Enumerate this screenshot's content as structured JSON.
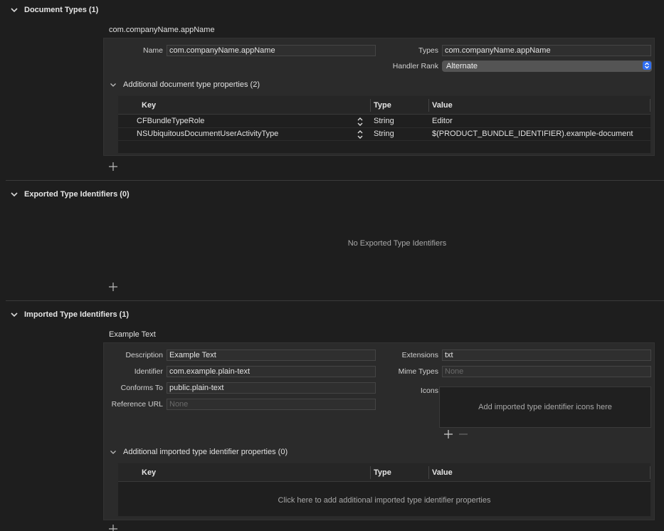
{
  "document_types": {
    "header": "Document Types (1)",
    "item_title": "com.companyName.appName",
    "name_label": "Name",
    "name_value": "com.companyName.appName",
    "types_label": "Types",
    "types_value": "com.companyName.appName",
    "handler_rank_label": "Handler Rank",
    "handler_rank_value": "Alternate",
    "additional_header": "Additional document type properties (2)",
    "table": {
      "columns": [
        "Key",
        "Type",
        "Value"
      ],
      "rows": [
        {
          "key": "CFBundleTypeRole",
          "type": "String",
          "value": "Editor"
        },
        {
          "key": "NSUbiquitousDocumentUserActivityType",
          "type": "String",
          "value": "$(PRODUCT_BUNDLE_IDENTIFIER).example-document"
        }
      ]
    }
  },
  "exported_types": {
    "header": "Exported Type Identifiers (0)",
    "empty_message": "No Exported Type Identifiers"
  },
  "imported_types": {
    "header": "Imported Type Identifiers (1)",
    "item_title": "Example Text",
    "description_label": "Description",
    "description_value": "Example Text",
    "identifier_label": "Identifier",
    "identifier_value": "com.example.plain-text",
    "conforms_label": "Conforms To",
    "conforms_value": "public.plain-text",
    "reference_url_label": "Reference URL",
    "reference_url_placeholder": "None",
    "extensions_label": "Extensions",
    "extensions_value": "txt",
    "mime_label": "Mime Types",
    "mime_placeholder": "None",
    "icons_label": "Icons",
    "icons_message": "Add imported type identifier icons here",
    "additional_header": "Additional imported type identifier properties (0)",
    "table": {
      "columns": [
        "Key",
        "Type",
        "Value"
      ],
      "empty_message": "Click here to add additional imported type identifier properties"
    }
  },
  "colors": {
    "background": "#1e1e1e",
    "panel": "#2b2b2b",
    "accent": "#2f6ef2"
  }
}
